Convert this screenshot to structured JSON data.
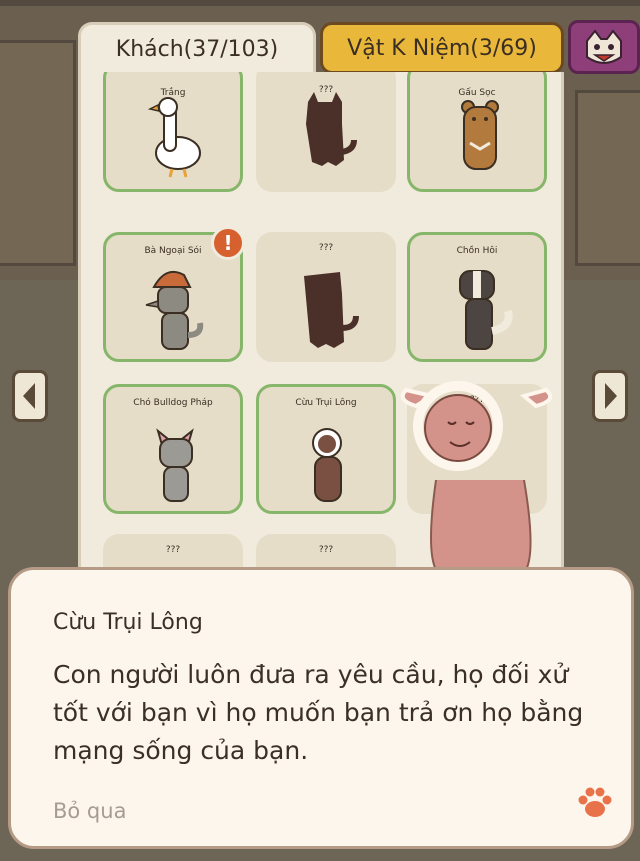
{
  "tabs": {
    "guests": "Khách(37/103)",
    "souvenirs": "Vật K Niệm(3/69)"
  },
  "badge_icon": "monster-face-icon",
  "cards": [
    {
      "name": "Trắng",
      "state": "found",
      "icon": "goose"
    },
    {
      "name": "???",
      "state": "unknown",
      "icon": "dog-silhouette"
    },
    {
      "name": "Gấu Sọc",
      "state": "found",
      "icon": "bear"
    },
    {
      "name": "Bà Ngoại Sói",
      "state": "found",
      "icon": "wolf-granny",
      "alert": "!"
    },
    {
      "name": "???",
      "state": "unknown",
      "icon": "dog-silhouette"
    },
    {
      "name": "Chồn Hôi",
      "state": "found",
      "icon": "badger"
    },
    {
      "name": "Chó Bulldog Pháp",
      "state": "found",
      "icon": "bulldog"
    },
    {
      "name": "Cừu Trụi Lông",
      "state": "found",
      "icon": "sheep"
    },
    {
      "name": "???",
      "state": "unknown",
      "icon": "blank"
    },
    {
      "name": "???",
      "state": "unknown",
      "icon": "blank"
    }
  ],
  "nav": {
    "prev_icon": "chevron-left-icon",
    "next_icon": "chevron-right-icon"
  },
  "dialog": {
    "speaker": "Cừu Trụi Lông",
    "message": "Con người luôn đưa ra yêu cầu, họ đối xử tốt với bạn vì họ muốn bạn trả ơn họ bằng mạng sống của bạn.",
    "skip_label": "Bỏ qua",
    "continue_icon": "paw-icon"
  },
  "colors": {
    "found_border": "#86b66a",
    "souvenir_tab": "#e9b83a",
    "alert": "#d6612e",
    "paw": "#e8734a"
  }
}
